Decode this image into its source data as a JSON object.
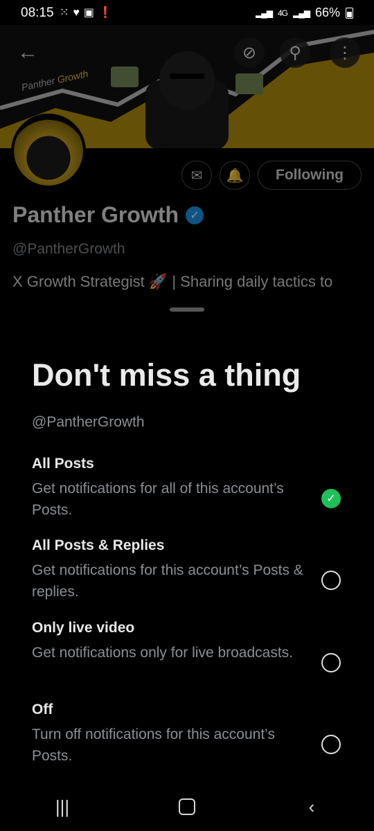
{
  "status_bar": {
    "time": "08:15",
    "notif_icons": [
      "grid-icon",
      "heart-icon",
      "image-icon",
      "alert-icon"
    ],
    "network": "4G",
    "battery": "66%"
  },
  "profile": {
    "banner_brand_part1": "Panther",
    "banner_brand_part2": "Growth",
    "name": "Panther Growth",
    "handle": "@PantherGrowth",
    "bio": "X Growth Strategist 🚀 | Sharing daily tactics to",
    "following_label": "Following"
  },
  "sheet": {
    "title": "Don't miss a thing",
    "subtitle": "@PantherGrowth",
    "options": [
      {
        "title": "All Posts",
        "desc": "Get notifications for all of this account’s Posts.",
        "selected": true
      },
      {
        "title": "All Posts & Replies",
        "desc": "Get notifications for this account’s Posts & replies.",
        "selected": false
      },
      {
        "title": "Only live video",
        "desc": "Get notifications only for live broadcasts.",
        "selected": false
      },
      {
        "title": "Off",
        "desc": "Turn off notifications for this account’s Posts.",
        "selected": false
      }
    ]
  },
  "colors": {
    "accent_green": "#1fbf5a",
    "verified_blue": "#1d9bf0",
    "banner_gold": "#e8c545"
  }
}
